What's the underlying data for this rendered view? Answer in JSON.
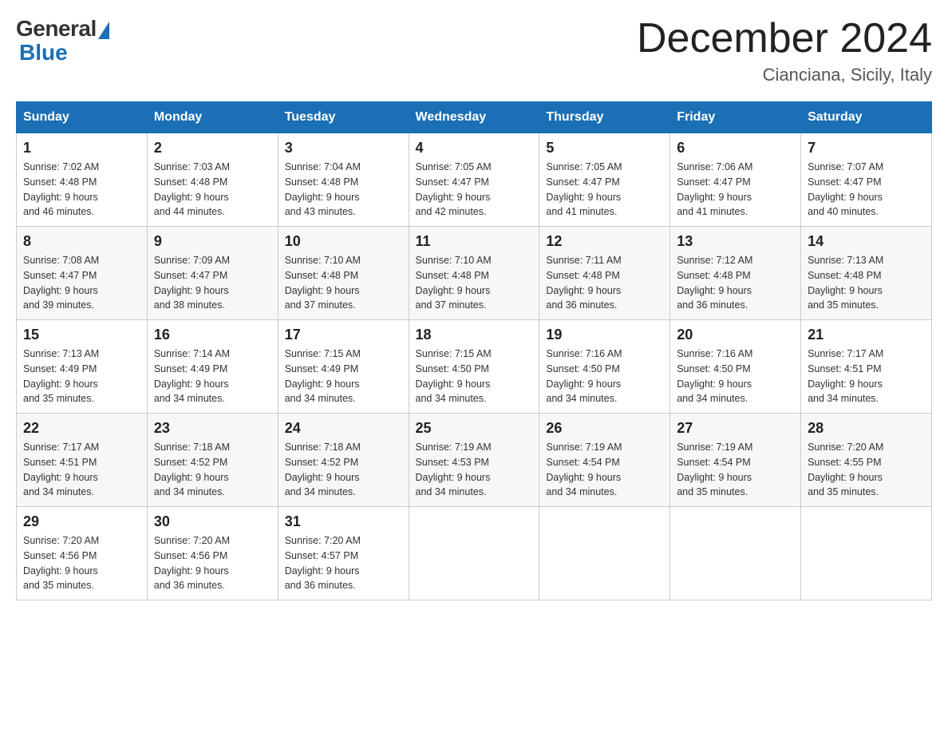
{
  "header": {
    "logo_general": "General",
    "logo_blue": "Blue",
    "month_title": "December 2024",
    "location": "Cianciana, Sicily, Italy"
  },
  "weekdays": [
    "Sunday",
    "Monday",
    "Tuesday",
    "Wednesday",
    "Thursday",
    "Friday",
    "Saturday"
  ],
  "weeks": [
    [
      {
        "day": "1",
        "sunrise": "7:02 AM",
        "sunset": "4:48 PM",
        "daylight": "9 hours and 46 minutes."
      },
      {
        "day": "2",
        "sunrise": "7:03 AM",
        "sunset": "4:48 PM",
        "daylight": "9 hours and 44 minutes."
      },
      {
        "day": "3",
        "sunrise": "7:04 AM",
        "sunset": "4:48 PM",
        "daylight": "9 hours and 43 minutes."
      },
      {
        "day": "4",
        "sunrise": "7:05 AM",
        "sunset": "4:47 PM",
        "daylight": "9 hours and 42 minutes."
      },
      {
        "day": "5",
        "sunrise": "7:05 AM",
        "sunset": "4:47 PM",
        "daylight": "9 hours and 41 minutes."
      },
      {
        "day": "6",
        "sunrise": "7:06 AM",
        "sunset": "4:47 PM",
        "daylight": "9 hours and 41 minutes."
      },
      {
        "day": "7",
        "sunrise": "7:07 AM",
        "sunset": "4:47 PM",
        "daylight": "9 hours and 40 minutes."
      }
    ],
    [
      {
        "day": "8",
        "sunrise": "7:08 AM",
        "sunset": "4:47 PM",
        "daylight": "9 hours and 39 minutes."
      },
      {
        "day": "9",
        "sunrise": "7:09 AM",
        "sunset": "4:47 PM",
        "daylight": "9 hours and 38 minutes."
      },
      {
        "day": "10",
        "sunrise": "7:10 AM",
        "sunset": "4:48 PM",
        "daylight": "9 hours and 37 minutes."
      },
      {
        "day": "11",
        "sunrise": "7:10 AM",
        "sunset": "4:48 PM",
        "daylight": "9 hours and 37 minutes."
      },
      {
        "day": "12",
        "sunrise": "7:11 AM",
        "sunset": "4:48 PM",
        "daylight": "9 hours and 36 minutes."
      },
      {
        "day": "13",
        "sunrise": "7:12 AM",
        "sunset": "4:48 PM",
        "daylight": "9 hours and 36 minutes."
      },
      {
        "day": "14",
        "sunrise": "7:13 AM",
        "sunset": "4:48 PM",
        "daylight": "9 hours and 35 minutes."
      }
    ],
    [
      {
        "day": "15",
        "sunrise": "7:13 AM",
        "sunset": "4:49 PM",
        "daylight": "9 hours and 35 minutes."
      },
      {
        "day": "16",
        "sunrise": "7:14 AM",
        "sunset": "4:49 PM",
        "daylight": "9 hours and 34 minutes."
      },
      {
        "day": "17",
        "sunrise": "7:15 AM",
        "sunset": "4:49 PM",
        "daylight": "9 hours and 34 minutes."
      },
      {
        "day": "18",
        "sunrise": "7:15 AM",
        "sunset": "4:50 PM",
        "daylight": "9 hours and 34 minutes."
      },
      {
        "day": "19",
        "sunrise": "7:16 AM",
        "sunset": "4:50 PM",
        "daylight": "9 hours and 34 minutes."
      },
      {
        "day": "20",
        "sunrise": "7:16 AM",
        "sunset": "4:50 PM",
        "daylight": "9 hours and 34 minutes."
      },
      {
        "day": "21",
        "sunrise": "7:17 AM",
        "sunset": "4:51 PM",
        "daylight": "9 hours and 34 minutes."
      }
    ],
    [
      {
        "day": "22",
        "sunrise": "7:17 AM",
        "sunset": "4:51 PM",
        "daylight": "9 hours and 34 minutes."
      },
      {
        "day": "23",
        "sunrise": "7:18 AM",
        "sunset": "4:52 PM",
        "daylight": "9 hours and 34 minutes."
      },
      {
        "day": "24",
        "sunrise": "7:18 AM",
        "sunset": "4:52 PM",
        "daylight": "9 hours and 34 minutes."
      },
      {
        "day": "25",
        "sunrise": "7:19 AM",
        "sunset": "4:53 PM",
        "daylight": "9 hours and 34 minutes."
      },
      {
        "day": "26",
        "sunrise": "7:19 AM",
        "sunset": "4:54 PM",
        "daylight": "9 hours and 34 minutes."
      },
      {
        "day": "27",
        "sunrise": "7:19 AM",
        "sunset": "4:54 PM",
        "daylight": "9 hours and 35 minutes."
      },
      {
        "day": "28",
        "sunrise": "7:20 AM",
        "sunset": "4:55 PM",
        "daylight": "9 hours and 35 minutes."
      }
    ],
    [
      {
        "day": "29",
        "sunrise": "7:20 AM",
        "sunset": "4:56 PM",
        "daylight": "9 hours and 35 minutes."
      },
      {
        "day": "30",
        "sunrise": "7:20 AM",
        "sunset": "4:56 PM",
        "daylight": "9 hours and 36 minutes."
      },
      {
        "day": "31",
        "sunrise": "7:20 AM",
        "sunset": "4:57 PM",
        "daylight": "9 hours and 36 minutes."
      },
      null,
      null,
      null,
      null
    ]
  ],
  "labels": {
    "sunrise": "Sunrise:",
    "sunset": "Sunset:",
    "daylight": "Daylight:"
  }
}
